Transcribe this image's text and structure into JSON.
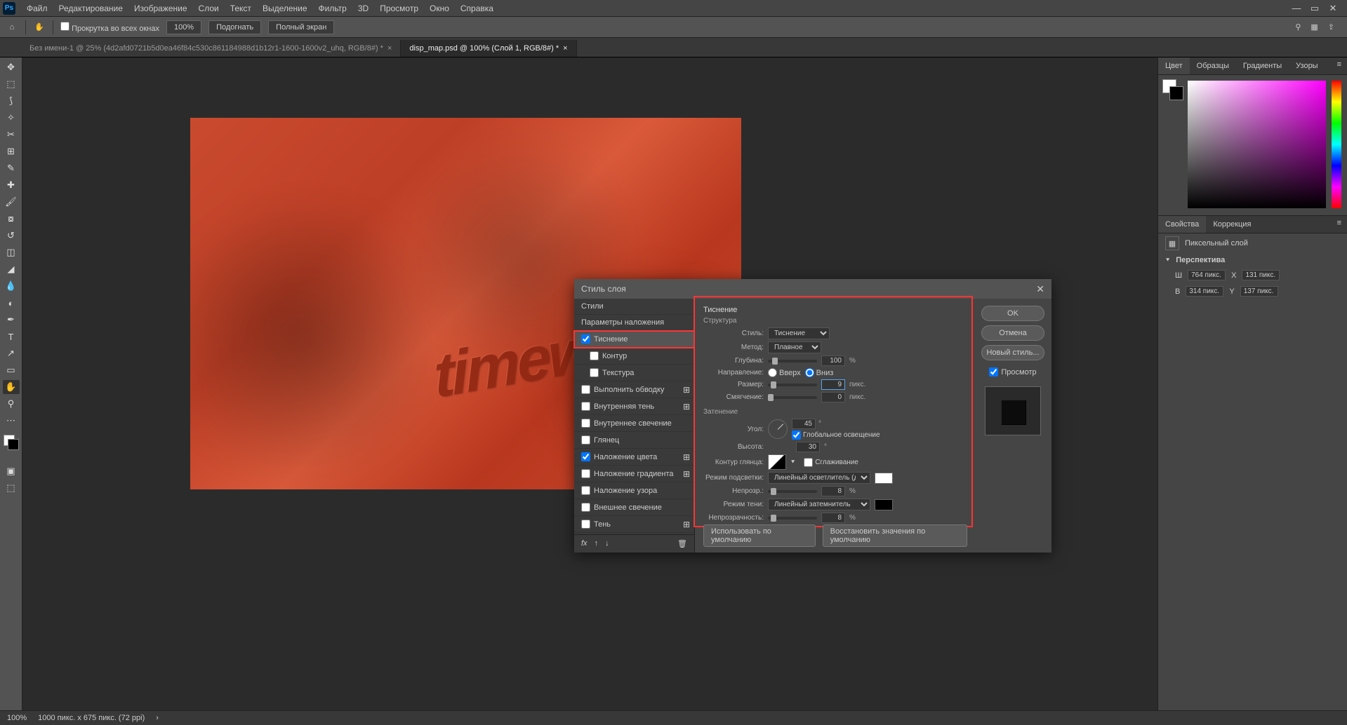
{
  "menu": {
    "items": [
      "Файл",
      "Редактирование",
      "Изображение",
      "Слои",
      "Текст",
      "Выделение",
      "Фильтр",
      "3D",
      "Просмотр",
      "Окно",
      "Справка"
    ]
  },
  "optbar": {
    "scroll": "Прокрутка во всех окнах",
    "zoom": "100%",
    "fit": "Подогнать",
    "full": "Полный экран"
  },
  "tabs": {
    "t1": "Без имени-1 @ 25% (4d2afd0721b5d0ea46f84c530c861184988d1b12r1-1600-1600v2_uhq, RGB/8#) *",
    "t2": "disp_map.psd @ 100% (Слой 1, RGB/8#) *"
  },
  "rpanel": {
    "color": "Цвет",
    "samples": "Образцы",
    "grad": "Градиенты",
    "patt": "Узоры",
    "props": "Свойства",
    "corr": "Коррекция",
    "pixlayer": "Пиксельный слой",
    "persp": "Перспектива",
    "w": "Ш",
    "wval": "764 пикс.",
    "x": "X",
    "xval": "131 пикс.",
    "h": "В",
    "hval": "314 пикс.",
    "y": "Y",
    "yval": "137 пикс."
  },
  "status": {
    "zoom": "100%",
    "dim": "1000 пикс. x 675 пикс. (72 ppi)"
  },
  "dlg": {
    "title": "Стиль слоя",
    "styles": "Стили",
    "blendopt": "Параметры наложения",
    "bevel": "Тиснение",
    "contour": "Контур",
    "texture": "Текстура",
    "stroke": "Выполнить обводку",
    "innershadow": "Внутренняя тень",
    "innerglow": "Внутреннее свечение",
    "satin": "Глянец",
    "coloroverlay": "Наложение цвета",
    "gradoverlay": "Наложение градиента",
    "pattoverlay": "Наложение узора",
    "outerglow": "Внешнее свечение",
    "dropshadow": "Тень",
    "sect_bevel": "Тиснение",
    "sect_struct": "Структура",
    "lbl_style": "Стиль:",
    "val_style": "Тиснение",
    "lbl_method": "Метод:",
    "val_method": "Плавное",
    "lbl_depth": "Глубина:",
    "val_depth": "100",
    "u_pct": "%",
    "lbl_dir": "Направление:",
    "dir_up": "Вверх",
    "dir_down": "Вниз",
    "lbl_size": "Размер:",
    "val_size": "9",
    "u_px": "пикс.",
    "lbl_soft": "Смягчение:",
    "val_soft": "0",
    "sect_shade": "Затенение",
    "lbl_angle": "Угол:",
    "val_angle": "45",
    "u_deg": "°",
    "global": "Глобальное освещение",
    "lbl_alt": "Высота:",
    "val_alt": "30",
    "lbl_gloss": "Контур глянца:",
    "anti": "Сглаживание",
    "lbl_himode": "Режим подсветки:",
    "val_himode": "Линейный осветлитель (добавить)",
    "lbl_opac": "Непрозр.:",
    "val_hiopac": "8",
    "lbl_shmode": "Режим тени:",
    "val_shmode": "Линейный затемнитель",
    "lbl_shopac": "Непрозрачность:",
    "val_shopac": "8",
    "ok": "OK",
    "cancel": "Отмена",
    "newstyle": "Новый стиль...",
    "preview": "Просмотр",
    "default": "Использовать по умолчанию",
    "reset": "Восстановить значения по умолчанию"
  }
}
